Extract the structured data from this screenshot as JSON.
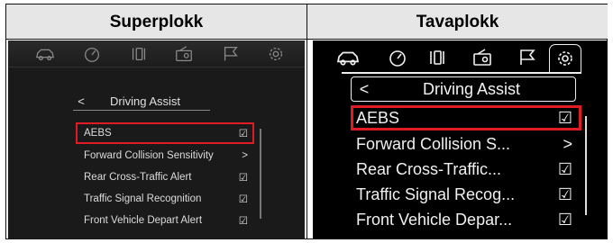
{
  "columns": {
    "left_header": "Superplokk",
    "right_header": "Tavaplokk"
  },
  "tab_icons": [
    "car-icon",
    "gauge-icon",
    "seat-icon",
    "radio-icon",
    "flag-icon",
    "gear-icon"
  ],
  "left_screen": {
    "back_symbol": "<",
    "title": "Driving Assist",
    "items": [
      {
        "label": "AEBS",
        "state": "☑",
        "highlighted": true
      },
      {
        "label": "Forward Collision Sensitivity",
        "state": ">"
      },
      {
        "label": "Rear Cross-Traffic Alert",
        "state": "☑"
      },
      {
        "label": "Traffic Signal Recognition",
        "state": "☑"
      },
      {
        "label": "Front Vehicle Depart Alert",
        "state": "☑"
      }
    ]
  },
  "right_screen": {
    "back_symbol": "<",
    "title": "Driving Assist",
    "items": [
      {
        "label": "AEBS",
        "state": "☑",
        "highlighted": true
      },
      {
        "label": "Forward Collision S...",
        "state": ">"
      },
      {
        "label": "Rear Cross-Traffic...",
        "state": "☑"
      },
      {
        "label": "Traffic Signal Recog...",
        "state": "☑"
      },
      {
        "label": "Front Vehicle Depar...",
        "state": "☑"
      }
    ]
  },
  "colors": {
    "highlight": "#e01b24",
    "header_bg": "#e6e6e6",
    "screen_dark": "#1a1a1a",
    "screen_black": "#000000"
  }
}
